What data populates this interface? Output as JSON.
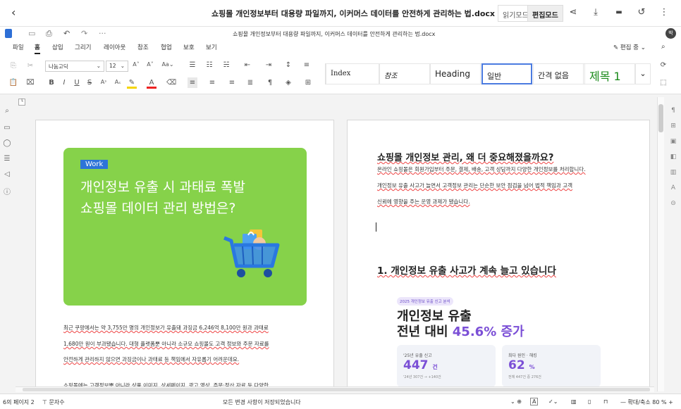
{
  "titlebar": {
    "doc_title": "쇼핑몰 개인정보부터 대용량 파일까지, 이커머스 데이터를 안전하게 관리하는 법.docx",
    "read_mode": "읽기모드",
    "edit_mode": "편집모드",
    "back_glyph": "‹",
    "share_glyph": "⋖",
    "download_glyph": "⤓",
    "comment_glyph": "▬",
    "history_glyph": "↺",
    "more_glyph": "⋮"
  },
  "docbar": {
    "filename": "쇼핑몰 개인정보부터 대용량 파일까지, 이커머스 데이터를 안전하게 관리하는 법.docx",
    "more": "···",
    "avatar": "박"
  },
  "menubar": {
    "items": [
      "파일",
      "홈",
      "삽입",
      "그리기",
      "레이아웃",
      "참조",
      "협업",
      "보호",
      "보기"
    ],
    "edit_status": "편집 중"
  },
  "ribbon": {
    "font_name": "나눔고딕",
    "font_size": "12",
    "styles": [
      "Index",
      "참조",
      "Heading",
      "일반",
      "간격 없음",
      "제목 1"
    ]
  },
  "page1": {
    "card_tag": "Work",
    "card_title_line1": "개인정보 유출 시 과태료 폭발",
    "card_title_line2": "쇼핑몰 데이터 관리 방법은?",
    "body_lines": [
      "최근 쿠팡에서는 약 3,755만 명의 개인정보가 유출돼 과징금 6,246억 8,100만 원과 과태료",
      "1,680만 원이 부과됐습니다. 대형 플랫폼뿐 아니라 소규모 쇼핑몰도 고객 정보와 주문 자료를",
      "안전하게 관리하지 않으면 과징금이나 과태료 등 책임에서 자유롭기 어려운데요.",
      "쇼핑몰에는 고객정보뿐 아니라 상품 이미지, 상세페이지, 광고 영상, 주문·정산 자료 등 다양한"
    ]
  },
  "page2": {
    "heading1": "쇼핑몰 개인정보 관리, 왜 더 중요해졌을까요?",
    "body_lines": [
      "온라인 쇼핑몰은 회원가입부터 주문, 결제, 배송, 고객 상담까지 다양한 개인정보를 처리합니다.",
      "개인정보 유출 사고가 늘면서 고객정보 관리는 단순한 보안 점검을 넘어 법적 책임과 고객",
      "신뢰에 영향을 주는 운영 과제가 됐습니다."
    ],
    "heading2": "1. 개인정보 유출 사고가 계속 늘고 있습니다",
    "infographic": {
      "badge": "2025 개인정보 유출 신고 분석",
      "title_line1": "개인정보 유출",
      "title_line2_prefix": "전년 대비 ",
      "title_line2_highlight": "45.6% 증가",
      "stats": [
        {
          "label": "'25년 유출 신고",
          "value": "447",
          "unit": "건",
          "note": "'24년 307건 → +140건"
        },
        {
          "label": "최다 원인 · 해킹",
          "value": "62",
          "unit": "%",
          "note": "전체 447건 중 276건"
        }
      ]
    }
  },
  "statusbar": {
    "page_info": "6의 페이지 2",
    "word_count": "문자수",
    "save_status": "모든 변경 사항이 저장되었습니다",
    "zoom": "확대/축소 80 %"
  },
  "colors": {
    "card_bg": "#86d24a",
    "tag_bg": "#2d74d8",
    "highlight_purple": "#7b4fd6",
    "heading1_style": "#1b8a1b"
  }
}
